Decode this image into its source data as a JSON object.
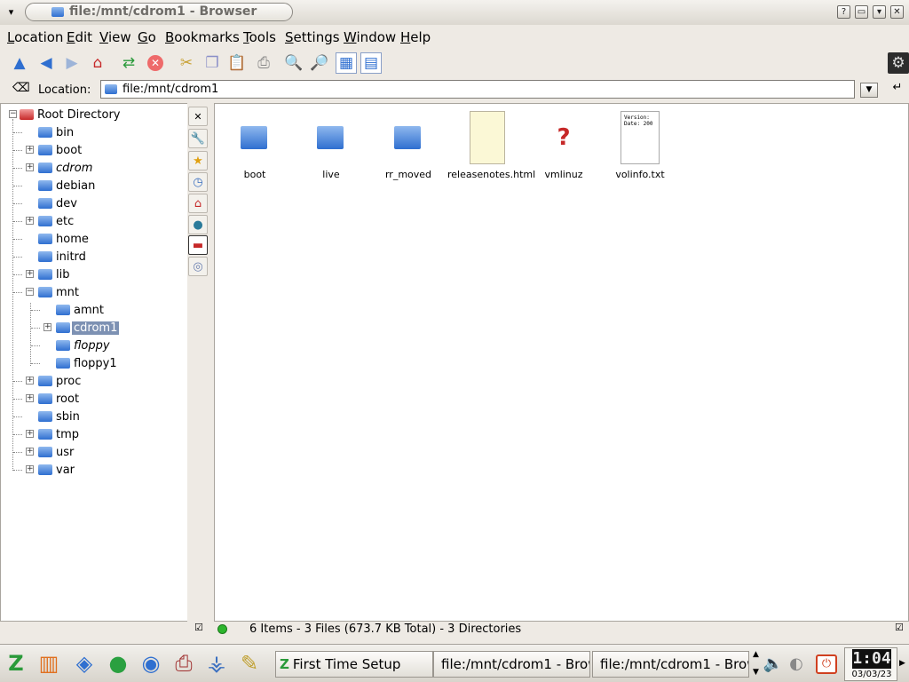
{
  "window": {
    "title": "file:/mnt/cdrom1 - Browser",
    "help_glyph": "?",
    "min_glyph": "▭",
    "max_glyph": "▾",
    "close_glyph": "✕",
    "menu_glyph": "▾"
  },
  "menu": [
    "Location",
    "Edit",
    "View",
    "Go",
    "Bookmarks",
    "Tools",
    "Settings",
    "Window",
    "Help"
  ],
  "toolbar_icons": [
    "up-icon",
    "back-icon",
    "forward-icon",
    "home-icon",
    "reload-icon",
    "stop-icon",
    "cut-icon",
    "copy-icon",
    "paste-icon",
    "print-icon",
    "zoom-in-icon",
    "zoom-out-icon",
    "icon-view-icon",
    "tree-view-icon",
    "activity-gear-icon"
  ],
  "location": {
    "label": "Location:",
    "value": "file:/mnt/cdrom1",
    "clear_glyph": "⌫",
    "dropdown_glyph": "▼",
    "go_glyph": "↵"
  },
  "tree": {
    "root": "Root Directory",
    "items": [
      {
        "label": "bin",
        "expandable": false,
        "italic": false
      },
      {
        "label": "boot",
        "expandable": true,
        "italic": false
      },
      {
        "label": "cdrom",
        "expandable": true,
        "italic": true
      },
      {
        "label": "debian",
        "expandable": false,
        "italic": false
      },
      {
        "label": "dev",
        "expandable": false,
        "italic": false
      },
      {
        "label": "etc",
        "expandable": true,
        "italic": false
      },
      {
        "label": "home",
        "expandable": false,
        "italic": false
      },
      {
        "label": "initrd",
        "expandable": false,
        "italic": false
      },
      {
        "label": "lib",
        "expandable": true,
        "italic": false
      },
      {
        "label": "mnt",
        "expandable": true,
        "italic": false
      },
      {
        "label": "amnt",
        "expandable": false,
        "italic": false
      },
      {
        "label": "cdrom1",
        "expandable": true,
        "italic": false
      },
      {
        "label": "floppy",
        "expandable": false,
        "italic": true
      },
      {
        "label": "floppy1",
        "expandable": false,
        "italic": false
      },
      {
        "label": "proc",
        "expandable": true,
        "italic": false
      },
      {
        "label": "root",
        "expandable": true,
        "italic": false
      },
      {
        "label": "sbin",
        "expandable": false,
        "italic": false
      },
      {
        "label": "tmp",
        "expandable": true,
        "italic": false
      },
      {
        "label": "usr",
        "expandable": true,
        "italic": false
      },
      {
        "label": "var",
        "expandable": true,
        "italic": false
      }
    ],
    "selected": "cdrom1"
  },
  "side_tabs": [
    "close-icon",
    "services-icon",
    "bookmarks-icon",
    "history-icon",
    "home-icon",
    "network-icon",
    "root-folder-icon",
    "media-icon"
  ],
  "files": [
    {
      "name": "boot",
      "type": "folder"
    },
    {
      "name": "live",
      "type": "folder"
    },
    {
      "name": "rr_moved",
      "type": "folder"
    },
    {
      "name": "releasenotes.html",
      "type": "html"
    },
    {
      "name": "vmlinuz",
      "type": "unknown"
    },
    {
      "name": "volinfo.txt",
      "type": "text",
      "preview": "Version:\nDate: 200"
    }
  ],
  "status": {
    "text": "6 Items - 3 Files (673.7 KB Total) - 3 Directories",
    "led_color": "#2db52d"
  },
  "taskbar": {
    "launchers": [
      "kmenu-icon",
      "firewall-icon",
      "cube-icon",
      "runner-icon",
      "globe-icon",
      "printer-icon",
      "network-icon",
      "editor-icon"
    ],
    "tasks": [
      "First Time Setup",
      "file:/mnt/cdrom1 - Brow",
      "file:/mnt/cdrom1 - Brow"
    ],
    "clock": "1:04",
    "date": "03/03/23"
  },
  "colors": {
    "selection": "#7d91b3",
    "folder_blue": "#2f6fd0",
    "root_red": "#c62828"
  }
}
